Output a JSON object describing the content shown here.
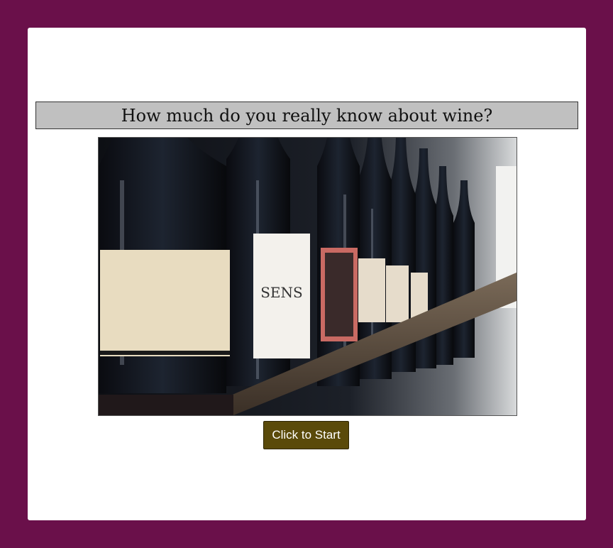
{
  "quiz": {
    "title": "How much do you really know about wine?",
    "start_label": "Click to Start"
  },
  "hero_image": {
    "subject": "wine bottles on a wooden shelf",
    "label_text": "SENS"
  },
  "colors": {
    "page_background": "#6a104a",
    "card_background": "#ffffff",
    "title_bar": "#c0c0c0",
    "button": "#5a4a0a"
  }
}
